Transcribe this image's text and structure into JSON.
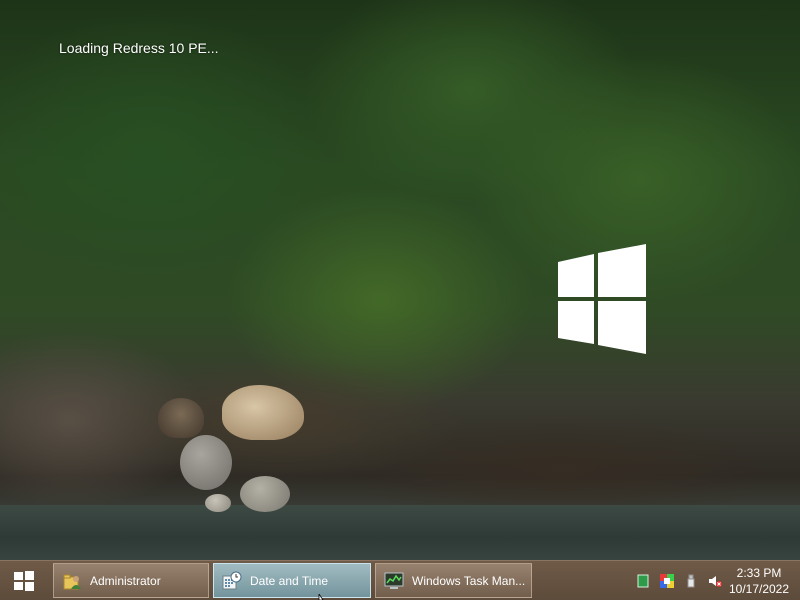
{
  "desktop": {
    "loading_text": "Loading Redress 10 PE..."
  },
  "taskbar": {
    "start_icon": "windows-logo-icon",
    "tasks": [
      {
        "label": "Administrator",
        "icon": "user-folder-icon",
        "active": false
      },
      {
        "label": "Date and Time",
        "icon": "calendar-clock-icon",
        "active": true
      },
      {
        "label": "Windows Task Man...",
        "icon": "task-manager-icon",
        "active": false
      }
    ],
    "tray": [
      {
        "icon": "green-square-icon"
      },
      {
        "icon": "color-palette-icon"
      },
      {
        "icon": "usb-drive-icon"
      },
      {
        "icon": "speaker-muted-icon"
      }
    ],
    "clock": {
      "time": "2:33 PM",
      "date": "10/17/2022"
    }
  },
  "colors": {
    "taskbar": "#665241",
    "active_task": "#8fb9c6",
    "text": "#ffffff"
  }
}
